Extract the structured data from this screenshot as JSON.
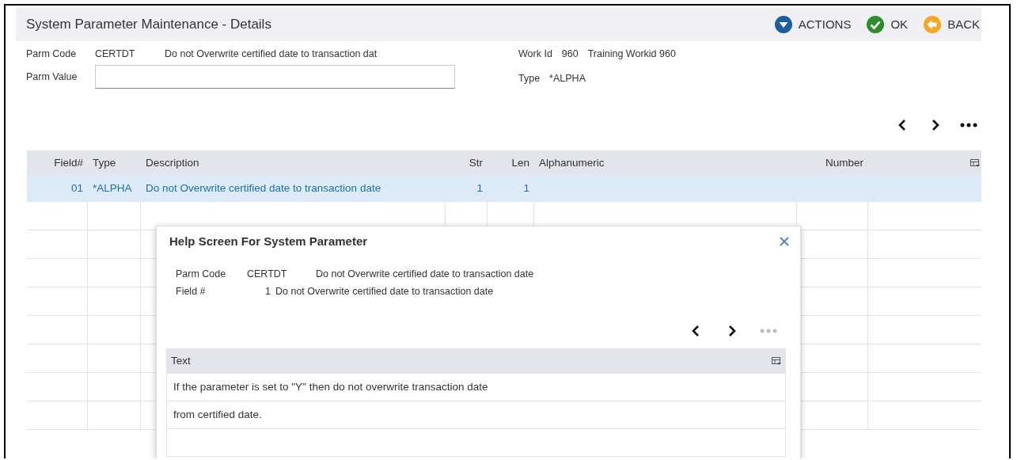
{
  "header": {
    "title": "System Parameter Maintenance - Details",
    "actions": [
      {
        "label": "ACTIONS",
        "kind": "dropdown"
      },
      {
        "label": "OK",
        "kind": "ok"
      },
      {
        "label": "BACK",
        "kind": "back"
      }
    ]
  },
  "form": {
    "parm_code_label": "Parm Code",
    "parm_code": "CERTDT",
    "parm_description": "Do not Overwrite certified date to transaction dat",
    "parm_value_label": "Parm Value",
    "work_id_label": "Work Id",
    "work_id": "960",
    "work_id_description": "Training Workid 960",
    "type_label": "Type",
    "type": "*ALPHA"
  },
  "pager": [
    {
      "kind": "prev",
      "disabled": false
    },
    {
      "kind": "next",
      "disabled": false
    },
    {
      "kind": "more",
      "disabled": false
    }
  ],
  "grid": {
    "columns": [
      {
        "label": "Field#",
        "kind": "numeric"
      },
      {
        "label": "Type",
        "kind": "text"
      },
      {
        "label": "Description",
        "kind": "text"
      },
      {
        "label": "Str",
        "kind": "numeric"
      },
      {
        "label": "Len",
        "kind": "numeric"
      },
      {
        "label": "Alphanumeric",
        "kind": "text"
      },
      {
        "label": "Number",
        "kind": "numeric"
      }
    ],
    "rows": [
      {
        "selected": true,
        "cells": [
          "01",
          "*ALPHA",
          "Do not Overwrite certified date to transaction date",
          "1",
          "1",
          "",
          ""
        ]
      }
    ]
  },
  "help_dialog": {
    "title": "Help Screen For System Parameter",
    "parm_code_label": "Parm Code",
    "parm_code": "CERTDT",
    "parm_description": "Do not Overwrite certified date to transaction date",
    "field_label": "Field #",
    "field_number": "1",
    "field_description": "Do not Overwrite certified date to transaction date",
    "pager": [
      {
        "kind": "prev",
        "disabled": false
      },
      {
        "kind": "next",
        "disabled": false
      },
      {
        "kind": "more",
        "disabled": true
      }
    ],
    "text_grid": {
      "column": "Text",
      "rows": [
        {
          "text": "If the parameter is set to \"Y\" then do not overwrite transaction date"
        },
        {
          "text": "from certified date."
        }
      ]
    }
  }
}
